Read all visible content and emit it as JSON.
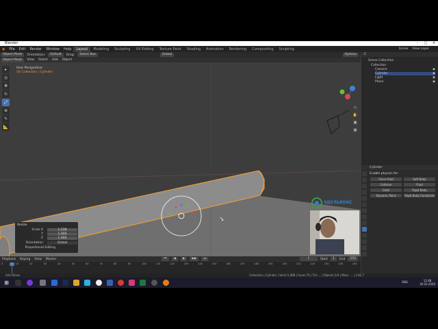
{
  "window": {
    "title": "Blender",
    "controls": [
      "–",
      "□",
      "✕"
    ]
  },
  "menu": [
    "File",
    "Edit",
    "Render",
    "Window",
    "Help"
  ],
  "workspaces": [
    "Layout",
    "Modeling",
    "Sculpting",
    "UV Editing",
    "Texture Paint",
    "Shading",
    "Animation",
    "Rendering",
    "Compositing",
    "Scripting"
  ],
  "active_workspace": "Layout",
  "scene": {
    "label": "Scene",
    "view_layer": "View Layer"
  },
  "header2": {
    "mode_left": "Object Mode",
    "orientation_label": "Orientation:",
    "orientation_value": "Default",
    "drag_label": "Drag:",
    "drag_value": "Select Box",
    "transform": "Global",
    "options": "Options"
  },
  "header3": {
    "mode": "Object Mode",
    "view": "View",
    "select": "Select",
    "add": "Add",
    "object": "Object"
  },
  "viewport": {
    "perspective": "User Perspective",
    "collection": "(0) Collection | Cylinder"
  },
  "resize_panel": {
    "title": "Resize",
    "rows": [
      {
        "label": "Scale X",
        "value": "1.238"
      },
      {
        "label": "Y",
        "value": "1.000"
      },
      {
        "label": "Z",
        "value": "1.000"
      },
      {
        "label": "Orientation",
        "value": "Global"
      },
      {
        "label": "Proportional Editing",
        "value": ""
      }
    ]
  },
  "outliner": {
    "root": "Scene Collection",
    "collection": "Collection",
    "items": [
      "Camera",
      "Cylinder",
      "Light",
      "Plane"
    ],
    "selected": "Cylinder"
  },
  "properties": {
    "object": "Cylinder",
    "section": "Enable physics for:",
    "buttons": [
      "Force Field",
      "Soft Body",
      "Collision",
      "Fluid",
      "Cloth",
      "Rigid Body",
      "Dynamic Paint",
      "Rigid Body Constraint"
    ]
  },
  "timeline": {
    "menus": [
      "Playback",
      "Keying",
      "View",
      "Marker"
    ],
    "current_frame": "1",
    "start_label": "Start",
    "start": "1",
    "end_label": "End",
    "end": "250",
    "ticks": [
      "0",
      "10",
      "20",
      "30",
      "40",
      "50",
      "60",
      "70",
      "80",
      "90",
      "100",
      "110",
      "120",
      "130",
      "140",
      "150",
      "160",
      "170",
      "180",
      "190",
      "200",
      "210",
      "220",
      "230",
      "240",
      "250"
    ]
  },
  "statusbar": {
    "left": "Anti-Aliase",
    "right": "Collection | Cylinder | Verts:1,088 | Faces:70 | Tris:... | Objects:1/4 | Mem: ... | 2.82.7"
  },
  "watermark": {
    "brand": "ЭДЕЛЬВЕЙС"
  },
  "taskbar": {
    "time": "12:48",
    "date": "30.03.2020",
    "lang": "ENG"
  }
}
